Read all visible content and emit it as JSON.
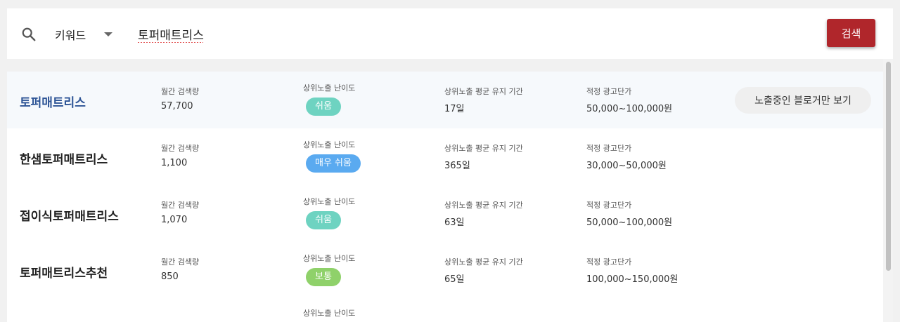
{
  "search": {
    "type_label": "키워드",
    "query": "토퍼매트리스",
    "button_label": "검색"
  },
  "labels": {
    "monthly_volume": "월간 검색량",
    "difficulty": "상위노출 난이도",
    "duration": "상위노출 평균 유지 기간",
    "ad_price": "적정 광고단가",
    "view_bloggers": "노출중인 블로거만 보기"
  },
  "rows": [
    {
      "keyword": "토퍼매트리스",
      "volume": "57,700",
      "difficulty": "쉬움",
      "difficulty_color": "#6ed3c1",
      "duration": "17일",
      "price": "50,000~100,000원"
    },
    {
      "keyword": "한샘토퍼매트리스",
      "volume": "1,100",
      "difficulty": "매우 쉬움",
      "difficulty_color": "#5aaaf0",
      "duration": "365일",
      "price": "30,000~50,000원"
    },
    {
      "keyword": "접이식토퍼매트리스",
      "volume": "1,070",
      "difficulty": "쉬움",
      "difficulty_color": "#6ed3c1",
      "duration": "63일",
      "price": "50,000~100,000원"
    },
    {
      "keyword": "토퍼매트리스추천",
      "volume": "850",
      "difficulty": "보통",
      "difficulty_color": "#8fd16a",
      "duration": "65일",
      "price": "100,000~150,000원"
    }
  ],
  "colors": {
    "accent": "#b0262b",
    "highlight_keyword": "#2e5596"
  }
}
